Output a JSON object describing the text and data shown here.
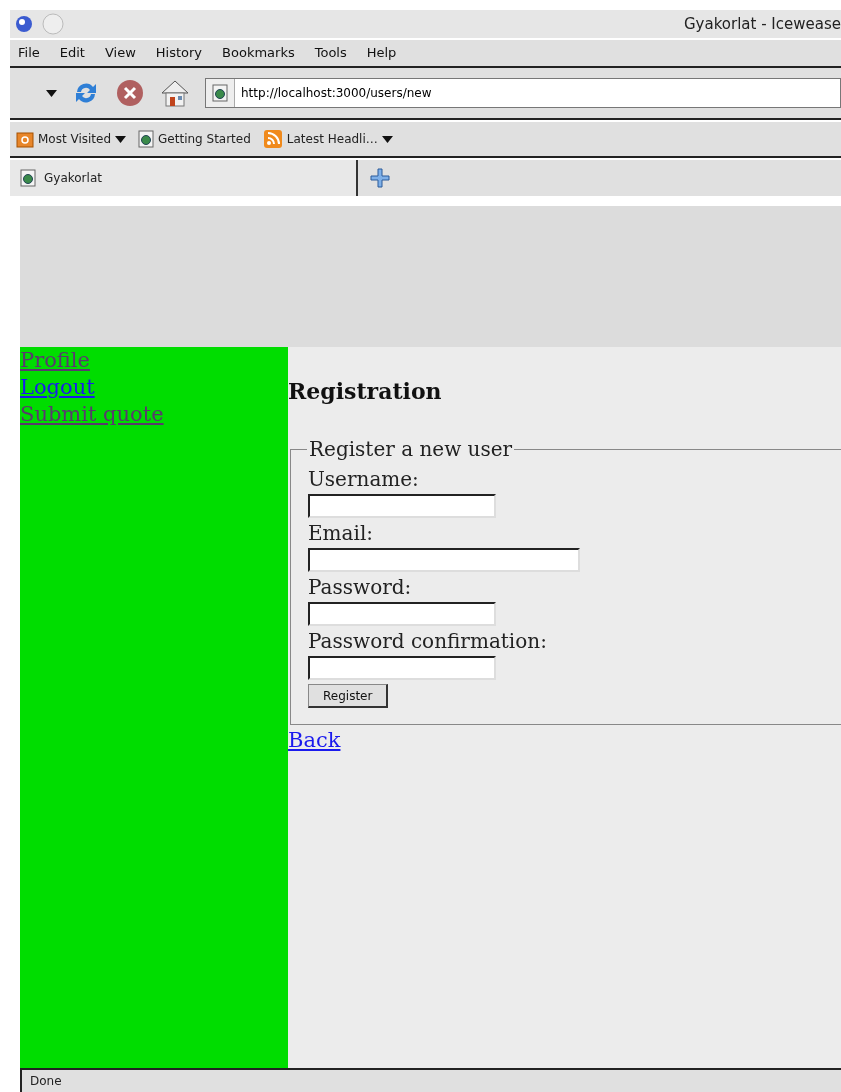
{
  "window": {
    "title": "Gyakorlat - Icewease"
  },
  "menu": [
    "File",
    "Edit",
    "View",
    "History",
    "Bookmarks",
    "Tools",
    "Help"
  ],
  "address": {
    "value": "http://localhost:3000/users/new"
  },
  "bookmarks": [
    {
      "label": "Most Visited",
      "kind": "folder",
      "dropdown": true
    },
    {
      "label": "Getting Started",
      "kind": "page",
      "dropdown": false
    },
    {
      "label": "Latest Headli…",
      "kind": "feed",
      "dropdown": true
    }
  ],
  "tabs": [
    {
      "label": "Gyakorlat",
      "selected": true
    }
  ],
  "sidebar": {
    "links": [
      {
        "label": "Profile",
        "visited": true
      },
      {
        "label": "Logout",
        "visited": false
      },
      {
        "label": "Submit quote",
        "visited": true
      }
    ]
  },
  "heading": "Registration",
  "form": {
    "legend": "Register a new user",
    "fields": [
      {
        "label": "Username:",
        "wide": false
      },
      {
        "label": "Email:",
        "wide": true
      },
      {
        "label": "Password:",
        "wide": false
      },
      {
        "label": "Password confirmation:",
        "wide": false
      }
    ],
    "button": "Register"
  },
  "back_link": {
    "label": "Back",
    "visited": false
  },
  "status_bar": "Done"
}
